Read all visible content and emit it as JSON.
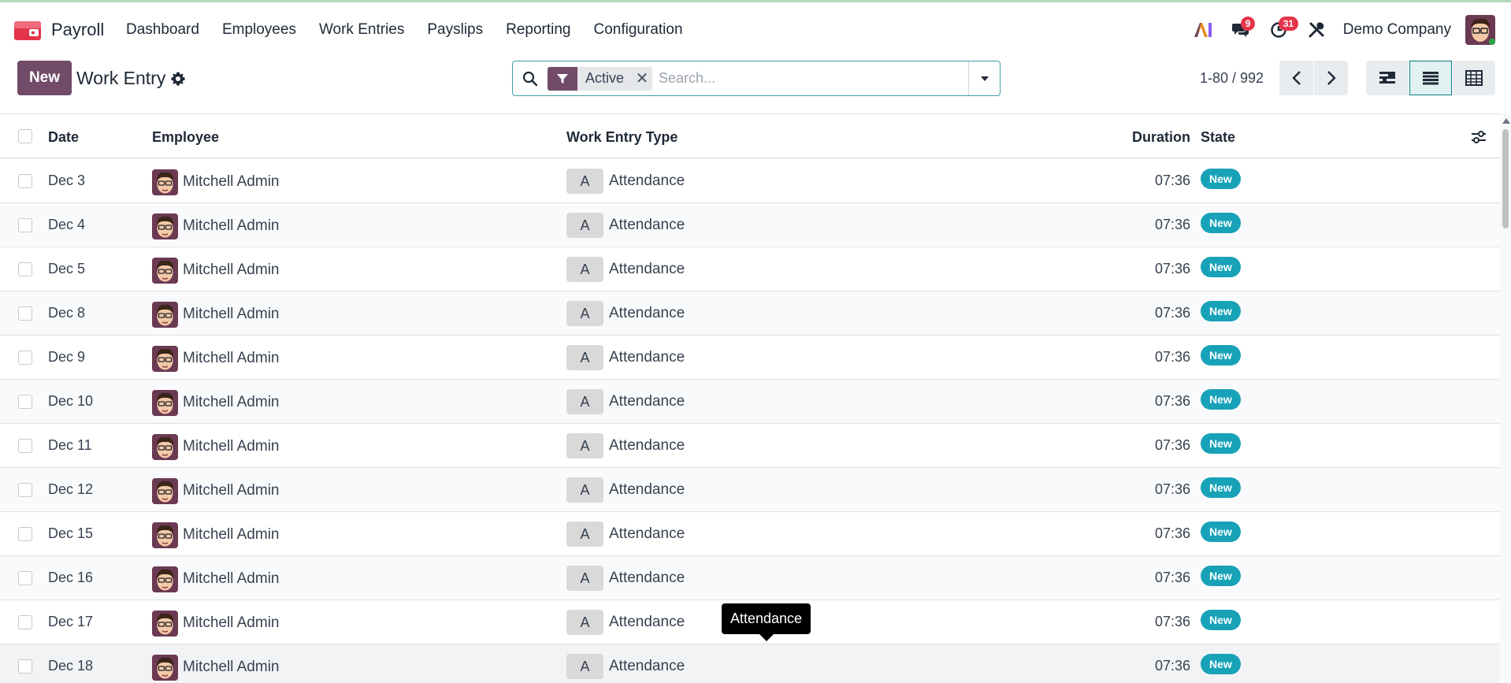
{
  "app": {
    "name": "Payroll"
  },
  "menu": [
    "Dashboard",
    "Employees",
    "Work Entries",
    "Payslips",
    "Reporting",
    "Configuration"
  ],
  "systray": {
    "messages_count": "9",
    "activities_count": "31",
    "company": "Demo Company"
  },
  "control": {
    "new_label": "New",
    "title": "Work Entry"
  },
  "search": {
    "facet_label": "Active",
    "placeholder": "Search..."
  },
  "pager": {
    "value": "1-80 / 992"
  },
  "columns": {
    "date": "Date",
    "employee": "Employee",
    "type": "Work Entry Type",
    "duration": "Duration",
    "state": "State"
  },
  "rows": [
    {
      "date": "Dec 3",
      "employee": "Mitchell Admin",
      "type_code": "A",
      "type": "Attendance",
      "duration": "07:36",
      "state": "New"
    },
    {
      "date": "Dec 4",
      "employee": "Mitchell Admin",
      "type_code": "A",
      "type": "Attendance",
      "duration": "07:36",
      "state": "New"
    },
    {
      "date": "Dec 5",
      "employee": "Mitchell Admin",
      "type_code": "A",
      "type": "Attendance",
      "duration": "07:36",
      "state": "New"
    },
    {
      "date": "Dec 8",
      "employee": "Mitchell Admin",
      "type_code": "A",
      "type": "Attendance",
      "duration": "07:36",
      "state": "New"
    },
    {
      "date": "Dec 9",
      "employee": "Mitchell Admin",
      "type_code": "A",
      "type": "Attendance",
      "duration": "07:36",
      "state": "New"
    },
    {
      "date": "Dec 10",
      "employee": "Mitchell Admin",
      "type_code": "A",
      "type": "Attendance",
      "duration": "07:36",
      "state": "New"
    },
    {
      "date": "Dec 11",
      "employee": "Mitchell Admin",
      "type_code": "A",
      "type": "Attendance",
      "duration": "07:36",
      "state": "New"
    },
    {
      "date": "Dec 12",
      "employee": "Mitchell Admin",
      "type_code": "A",
      "type": "Attendance",
      "duration": "07:36",
      "state": "New"
    },
    {
      "date": "Dec 15",
      "employee": "Mitchell Admin",
      "type_code": "A",
      "type": "Attendance",
      "duration": "07:36",
      "state": "New"
    },
    {
      "date": "Dec 16",
      "employee": "Mitchell Admin",
      "type_code": "A",
      "type": "Attendance",
      "duration": "07:36",
      "state": "New"
    },
    {
      "date": "Dec 17",
      "employee": "Mitchell Admin",
      "type_code": "A",
      "type": "Attendance",
      "duration": "07:36",
      "state": "New"
    },
    {
      "date": "Dec 18",
      "employee": "Mitchell Admin",
      "type_code": "A",
      "type": "Attendance",
      "duration": "07:36",
      "state": "New"
    }
  ],
  "tooltip": "Attendance",
  "colors": {
    "brand": "#714b67",
    "accent": "#017e84",
    "badge": "#17a2b8",
    "notif": "#e4344a"
  }
}
